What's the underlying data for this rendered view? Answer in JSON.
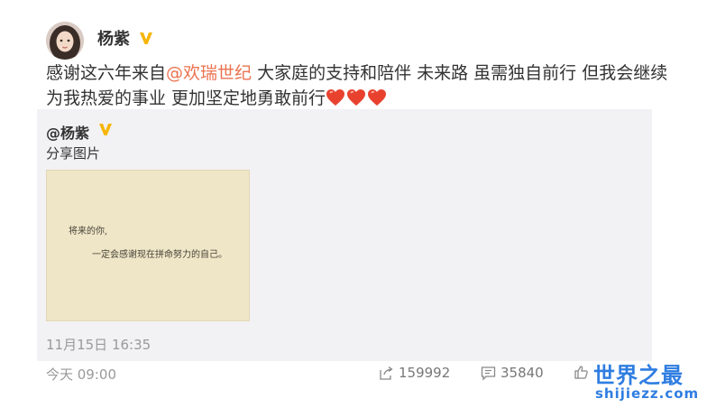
{
  "post": {
    "username": "杨紫",
    "text_before_mention": "感谢这六年来自",
    "mention": "@欢瑞世纪",
    "text_after_mention": " 大家庭的支持和陪伴 未来路 虽需独自前行 但我会继续为我热爱的事业 更加坚定地勇敢前行",
    "time": "今天 09:00"
  },
  "repost": {
    "user": "@杨紫",
    "text": "分享图片",
    "image_line1": "将来的你,",
    "image_line2": "一定会感谢现在拼命努力的自己。",
    "time": "11月15日 16:35"
  },
  "actions": {
    "share_count": "159992",
    "comment_count": "35840"
  },
  "watermark": {
    "title": "世界之最",
    "url": "shijiezz.com"
  },
  "colors": {
    "mention": "#eb7350",
    "verified": "#f7b500",
    "heart": "#e8422f",
    "watermark": "#2f7de1",
    "repost_background": "#f2f2f5"
  },
  "icons": [
    "verified-badge-icon",
    "heart-icon",
    "share-icon",
    "comment-icon",
    "like-icon"
  ]
}
